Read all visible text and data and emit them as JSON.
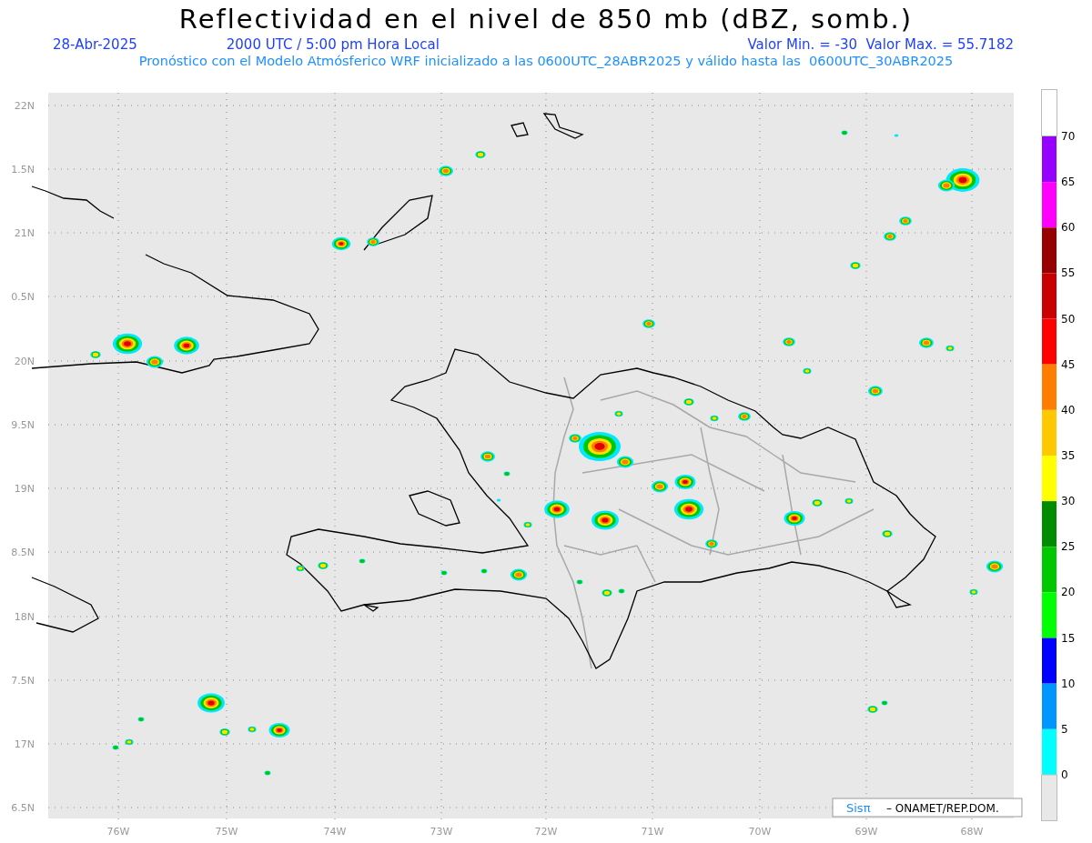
{
  "title": "Reflectividad en el nivel de 850 mb (dBZ, somb.)",
  "info_line": {
    "date": "28-Abr-2025",
    "time": "2000 UTC / 5:00 pm Hora Local",
    "min_max": "Valor Min. = -30  Valor Max. = 55.7182"
  },
  "forecast_line": "Pronóstico con el Modelo Atmósferico WRF inicializado a las 0600UTC_28ABR2025 y válido hasta las  0600UTC_30ABR2025",
  "map": {
    "latitude_labels": [
      "22N",
      "1.5N",
      "21N",
      "0.5N",
      "20N",
      "9.5N",
      "19N",
      "8.5N",
      "18N",
      "7.5N",
      "17N",
      "6.5N"
    ],
    "longitude_labels": [
      "76W",
      "75W",
      "74W",
      "73W",
      "72W",
      "71W",
      "70W",
      "69W",
      "68W"
    ]
  },
  "colorbar": {
    "labels": [
      "70",
      "65",
      "60",
      "55",
      "50",
      "45",
      "40",
      "35",
      "30",
      "25",
      "20",
      "15",
      "10",
      "5",
      "0"
    ],
    "segments": [
      {
        "color": "#9600ff"
      },
      {
        "color": "#ff00ff"
      },
      {
        "color": "#960000"
      },
      {
        "color": "#c80000"
      },
      {
        "color": "#ff0000"
      },
      {
        "color": "#ff7d00"
      },
      {
        "color": "#ffc800"
      },
      {
        "color": "#ffff00"
      },
      {
        "color": "#008c00"
      },
      {
        "color": "#00c800"
      },
      {
        "color": "#00ff00"
      },
      {
        "color": "#0000ff"
      },
      {
        "color": "#0096ff"
      },
      {
        "color": "#00ffff"
      }
    ]
  },
  "credit": {
    "logo": "Sisπ",
    "text": "– ONAMET/REP.DOM."
  }
}
